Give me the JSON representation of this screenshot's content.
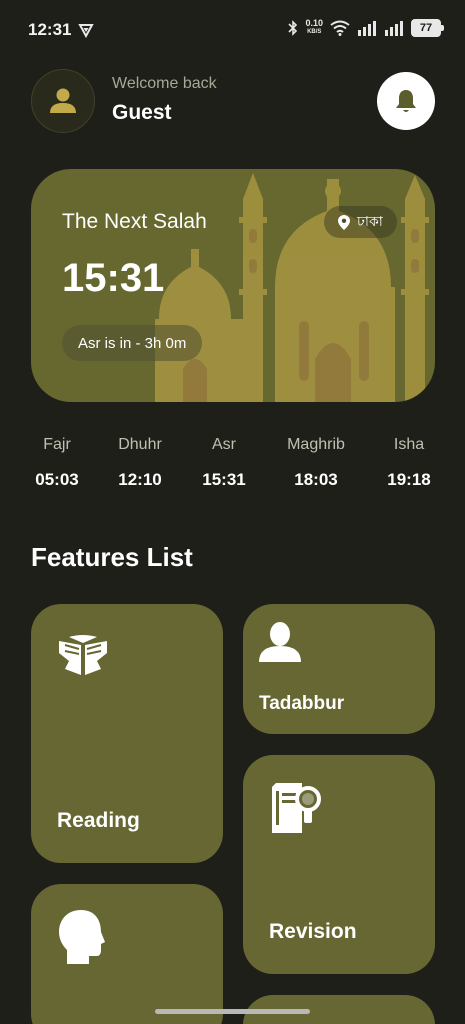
{
  "status_bar": {
    "time": "12:31",
    "speed_value": "0.10",
    "speed_unit": "KB/S",
    "battery": "77"
  },
  "header": {
    "welcome": "Welcome back",
    "username": "Guest"
  },
  "salah_card": {
    "title": "The Next Salah",
    "location": "ঢাকা",
    "time": "15:31",
    "countdown": "Asr is in - 3h 0m"
  },
  "prayers": [
    {
      "name": "Fajr",
      "time": "05:03"
    },
    {
      "name": "Dhuhr",
      "time": "12:10"
    },
    {
      "name": "Asr",
      "time": "15:31"
    },
    {
      "name": "Maghrib",
      "time": "18:03"
    },
    {
      "name": "Isha",
      "time": "19:18"
    }
  ],
  "features": {
    "title": "Features List",
    "items": [
      {
        "label": "Reading",
        "icon": "open-book-icon"
      },
      {
        "label": "Tadabbur",
        "icon": "person-icon"
      },
      {
        "label": "Revision",
        "icon": "book-search-icon"
      },
      {
        "label": "",
        "icon": "head-profile-icon"
      }
    ]
  },
  "colors": {
    "background": "#1e1f18",
    "card": "#666733",
    "mosque": "#c2a94a"
  }
}
